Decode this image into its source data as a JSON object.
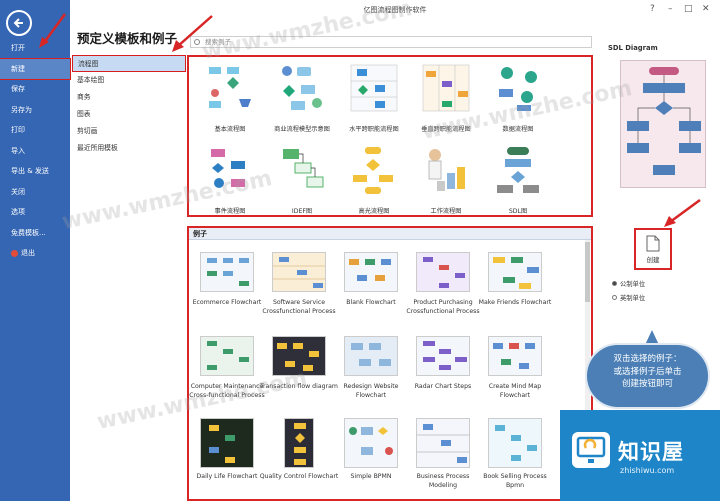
{
  "app": {
    "title": "亿图流程图制作软件",
    "window_controls": [
      "?",
      "–",
      "□",
      "✕"
    ]
  },
  "file_menu": {
    "items": [
      "打开",
      "新建",
      "保存",
      "另存为",
      "打印",
      "导入",
      "导出 & 发送",
      "关闭",
      "选项",
      "免费模板...",
      "退出"
    ],
    "selected_index": 1
  },
  "page_title": "预定义模板和例子",
  "search": {
    "placeholder": "搜索例子"
  },
  "categories": {
    "items": [
      "流程图",
      "基本绘图",
      "商务",
      "图表",
      "剪切画",
      "最近所用模板"
    ],
    "selected_index": 0
  },
  "templates": [
    {
      "label": "基本流程图"
    },
    {
      "label": "商业流程模型示意图"
    },
    {
      "label": "水平跨职能流程图"
    },
    {
      "label": "垂直跨职能流程图"
    },
    {
      "label": "数据流程图"
    },
    {
      "label": "事件流程图"
    },
    {
      "label": "IDEF图"
    },
    {
      "label": "高光流程图"
    },
    {
      "label": "工作流程图"
    },
    {
      "label": "SDL图"
    }
  ],
  "examples": {
    "heading": "例子",
    "items": [
      {
        "label": "Ecommerce Flowchart"
      },
      {
        "label": "Software Service Crossfunctional Process"
      },
      {
        "label": "Blank Flowchart"
      },
      {
        "label": "Product Purchasing Crossfunctional Process"
      },
      {
        "label": "Make Friends Flowchart"
      },
      {
        "label": "Computer Maintenance Cross-functional Process"
      },
      {
        "label": "Transaction flow diagram"
      },
      {
        "label": "Redesign Website Flowchart"
      },
      {
        "label": "Radar Chart Steps"
      },
      {
        "label": "Create Mind Map Flowchart"
      },
      {
        "label": "Daily Life Flowchart"
      },
      {
        "label": "Quality Control Flowchart"
      },
      {
        "label": "Simple BPMN"
      },
      {
        "label": "Business Process Modeling"
      },
      {
        "label": "Book Selling Process Bpmn"
      }
    ]
  },
  "preview": {
    "title": "SDL Diagram",
    "create_label": "创建",
    "units": [
      {
        "label": "公制单位",
        "selected": true
      },
      {
        "label": "英制单位",
        "selected": false
      }
    ]
  },
  "callout": {
    "line1": "双击选择的例子：",
    "line2": "或选择例子后单击",
    "line3": "创建按钮即可"
  },
  "logo": {
    "name": "知识屋",
    "url": "zhishiwu.com"
  },
  "watermarks": [
    "www.wmzhe.com",
    "www.wmzhe.com",
    "www.wmzhe.com",
    "www.wmzhe.com"
  ],
  "colors": {
    "nav_bg": "#3566b3",
    "highlight_border": "#d82626",
    "accent_blue": "#4b7fb6",
    "logo_bg": "#1e86c8"
  }
}
